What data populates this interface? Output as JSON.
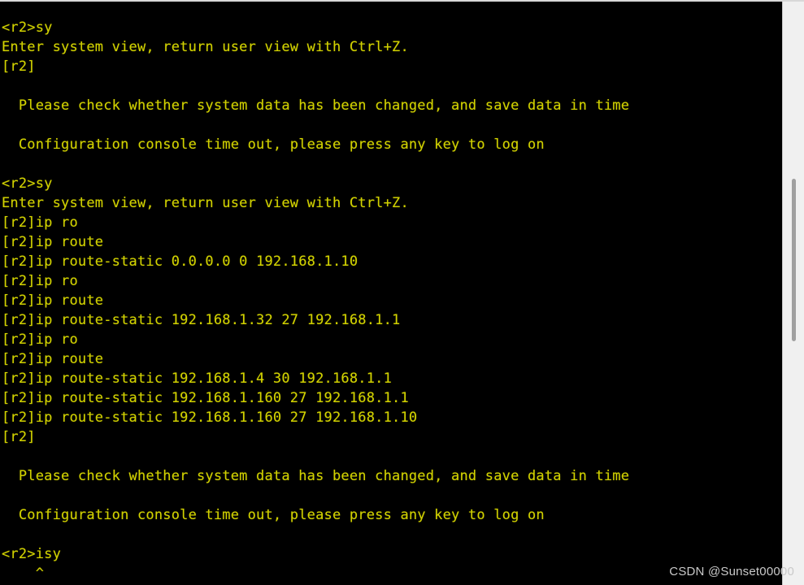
{
  "terminal": {
    "prompt_user": "<r2>",
    "prompt_system": "[r2]",
    "foreground_color": "#d2d200",
    "background_color": "#000000",
    "lines": [
      "<r2>sy",
      "Enter system view, return user view with Ctrl+Z.",
      "[r2]",
      "",
      "  Please check whether system data has been changed, and save data in time",
      "",
      "  Configuration console time out, please press any key to log on",
      "",
      "<r2>sy",
      "Enter system view, return user view with Ctrl+Z.",
      "[r2]ip ro",
      "[r2]ip route",
      "[r2]ip route-static 0.0.0.0 0 192.168.1.10",
      "[r2]ip ro",
      "[r2]ip route",
      "[r2]ip route-static 192.168.1.32 27 192.168.1.1",
      "[r2]ip ro",
      "[r2]ip route",
      "[r2]ip route-static 192.168.1.4 30 192.168.1.1",
      "[r2]ip route-static 192.168.1.160 27 192.168.1.1",
      "[r2]ip route-static 192.168.1.160 27 192.168.1.10",
      "[r2]",
      "",
      "  Please check whether system data has been changed, and save data in time",
      "",
      "  Configuration console time out, please press any key to log on",
      "",
      "<r2>isy",
      "    ^"
    ]
  },
  "scrollbar": {
    "orientation": "vertical",
    "track_color": "#f0f0f0",
    "thumb_color": "#a0a0a0"
  },
  "watermark": {
    "text": "CSDN @Sunset00000"
  }
}
